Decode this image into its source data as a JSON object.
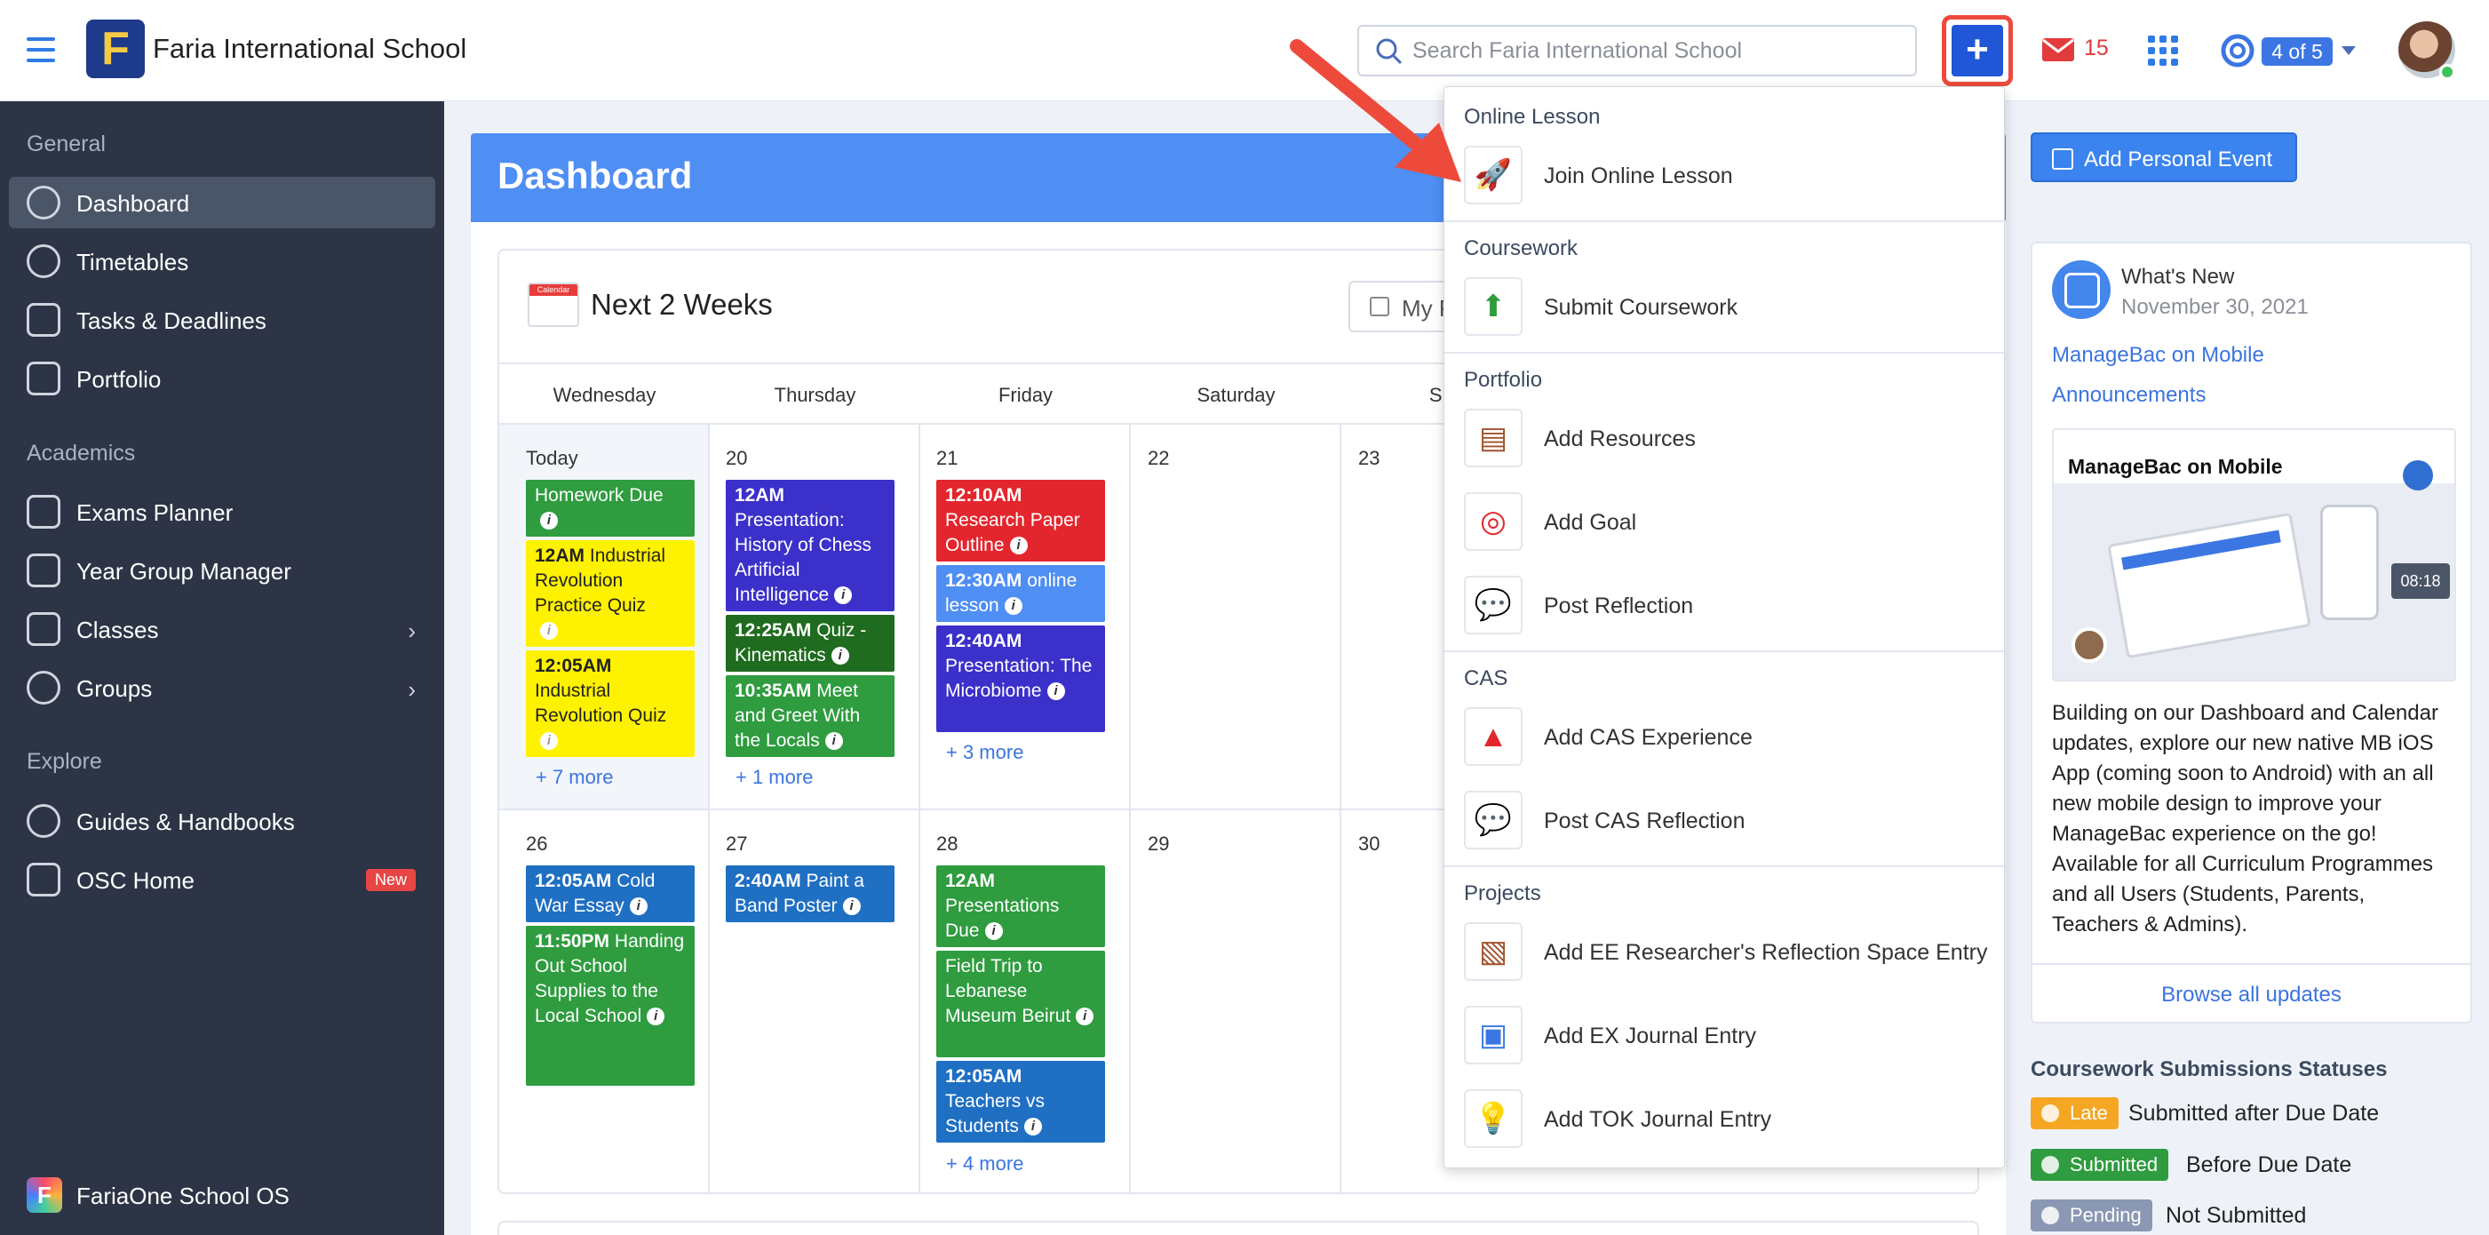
{
  "header": {
    "school_name": "Faria International School",
    "logo_letter": "F",
    "search_placeholder": "Search Faria International School",
    "mail_count": "15",
    "support_badge": "4 of 5"
  },
  "sidebar": {
    "sections": [
      "General",
      "Academics",
      "Explore"
    ],
    "items": [
      {
        "label": "Dashboard",
        "icon": "dashboard-icon"
      },
      {
        "label": "Timetables",
        "icon": "clock-icon"
      },
      {
        "label": "Tasks & Deadlines",
        "icon": "calendar-icon"
      },
      {
        "label": "Portfolio",
        "icon": "briefcase-icon"
      },
      {
        "label": "Exams Planner",
        "icon": "list-icon"
      },
      {
        "label": "Year Group Manager",
        "icon": "dp-icon"
      },
      {
        "label": "Classes",
        "icon": "person-icon"
      },
      {
        "label": "Groups",
        "icon": "people-icon"
      },
      {
        "label": "Guides & Handbooks",
        "icon": "guides-icon"
      },
      {
        "label": "OSC Home",
        "icon": "osc-icon",
        "badge": "New"
      }
    ],
    "footer_label": "FariaOne School OS",
    "footer_logo": "F"
  },
  "dashboard": {
    "title": "Dashboard",
    "calendar_title": "Next 2 Weeks",
    "calendar_icon_text": "Calendar",
    "filter_label": "My F",
    "days": [
      "Wednesday",
      "Thursday",
      "Friday",
      "Saturday",
      "Sun"
    ],
    "week1": {
      "dates": [
        "Today",
        "20",
        "21",
        "22",
        "23"
      ],
      "more": [
        "+ 7 more",
        "+ 1 more",
        "+ 3 more"
      ]
    },
    "week2": {
      "dates": [
        "26",
        "27",
        "28",
        "29",
        "30"
      ],
      "more": [
        "+ 4 more"
      ]
    },
    "events": [
      {
        "time": "",
        "title": "Homework Due",
        "color": "#2e9c3f"
      },
      {
        "time": "12AM",
        "title": "Industrial Revolution Practice Quiz",
        "color": "#fff200"
      },
      {
        "time": "12:05AM",
        "title": "Industrial Revolution Quiz",
        "color": "#fff200"
      },
      {
        "time": "12AM",
        "title": "Presentation: History of Chess Artificial Intelligence",
        "color": "#3b30c9"
      },
      {
        "time": "12:25AM",
        "title": "Quiz - Kinematics",
        "color": "#1f6b1f"
      },
      {
        "time": "10:35AM",
        "title": "Meet and Greet With the Locals",
        "color": "#2e9c3f"
      },
      {
        "time": "12:10AM",
        "title": "Research Paper Outline",
        "color": "#e3262d"
      },
      {
        "time": "12:30AM",
        "title": "online lesson",
        "color": "#4f8ef3"
      },
      {
        "time": "12:40AM",
        "title": "Presentation: The Microbiome",
        "color": "#3b30c9"
      },
      {
        "time": "12:05AM",
        "title": "Cold War Essay",
        "color": "#1f6fc2"
      },
      {
        "time": "11:50PM",
        "title": "Handing Out School Supplies to the Local School",
        "color": "#2e9c3f"
      },
      {
        "time": "2:40AM",
        "title": "Paint a Band Poster",
        "color": "#1f6fc2"
      },
      {
        "time": "12AM",
        "title": "Presentations Due",
        "color": "#2e9c3f"
      },
      {
        "time": "",
        "title": "Field Trip to Lebanese Museum Beirut",
        "color": "#2e9c3f"
      },
      {
        "time": "12:05AM",
        "title": "Teachers vs Students",
        "color": "#1f6fc2"
      }
    ]
  },
  "menu": {
    "sections": [
      {
        "title": "Online Lesson",
        "items": [
          {
            "label": "Join Online Lesson",
            "icon": "rocket-icon"
          }
        ]
      },
      {
        "title": "Coursework",
        "items": [
          {
            "label": "Submit Coursework",
            "icon": "upload-icon"
          }
        ]
      },
      {
        "title": "Portfolio",
        "items": [
          {
            "label": "Add Resources",
            "icon": "chest-icon"
          },
          {
            "label": "Add Goal",
            "icon": "target-icon"
          },
          {
            "label": "Post Reflection",
            "icon": "speech-bubble-icon"
          }
        ]
      },
      {
        "title": "CAS",
        "items": [
          {
            "label": "Add CAS Experience",
            "icon": "cas-triangle-icon"
          },
          {
            "label": "Post CAS Reflection",
            "icon": "speech-bubble-icon"
          }
        ]
      },
      {
        "title": "Projects",
        "items": [
          {
            "label": "Add EE Researcher's Reflection Space Entry",
            "icon": "notebook-icon"
          },
          {
            "label": "Add EX Journal Entry",
            "icon": "photo-icon"
          },
          {
            "label": "Add TOK Journal Entry",
            "icon": "lightbulb-icon"
          }
        ]
      }
    ]
  },
  "right": {
    "add_personal_event": "Add Personal Event",
    "whats_new_title": "What's New",
    "whats_new_date": "November 30, 2021",
    "link1": "ManageBac on Mobile",
    "link2": "Announcements",
    "promo_title": "ManageBac on Mobile",
    "promo_clock": "08:18",
    "news_text": "Building on our Dashboard and Calendar updates, explore our new native MB iOS App (coming soon to Android) with an all new mobile design to improve your ManageBac experience on the go! Available for all Curriculum Programmes and all Users (Students, Parents, Teachers & Admins).",
    "browse_all": "Browse all updates",
    "coursework_title": "Coursework Submissions Statuses",
    "statuses": [
      {
        "badge": "Late",
        "desc": "Submitted after Due Date",
        "color": "#f5a623"
      },
      {
        "badge": "Submitted",
        "desc": "Before Due Date",
        "color": "#2e9c3f"
      },
      {
        "badge": "Pending",
        "desc": "Not Submitted",
        "color": "#8a98b3"
      }
    ]
  }
}
